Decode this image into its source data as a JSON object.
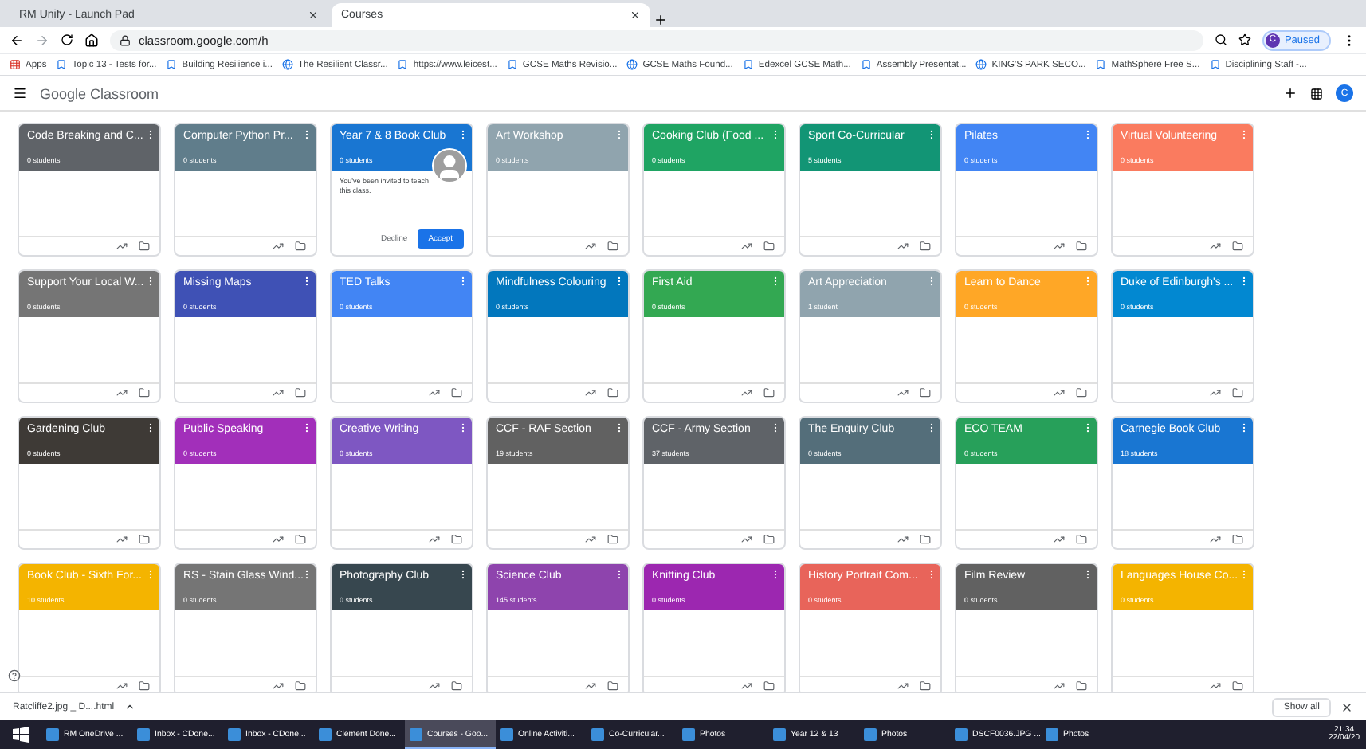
{
  "browser_tabs": [
    {
      "title": "RM Unify - Launch Pad",
      "selected": false
    },
    {
      "title": "Courses",
      "selected": true
    }
  ],
  "address": "classroom.google.com/h",
  "profile": {
    "initial": "C",
    "status": "Paused"
  },
  "bookmarks": [
    "Apps",
    "Topic 13 - Tests for...",
    "Building Resilience i...",
    "The Resilient Classr...",
    "https://www.leicest...",
    "GCSE Maths Revisio...",
    "GCSE Maths Found...",
    "Edexcel GCSE Math...",
    "Assembly Presentat...",
    "KING'S PARK SECO...",
    "MathSphere Free S...",
    "Disciplining Staff -..."
  ],
  "app_bar": {
    "brand": "Google",
    "product": "Classroom",
    "avatar": "C"
  },
  "courses": [
    {
      "title": "Code Breaking and C...",
      "students": "0 students",
      "color": "#5f6368"
    },
    {
      "title": "Computer Python Pr...",
      "students": "0 students",
      "color": "#607d8b"
    },
    {
      "title": "Year 7 & 8 Book Club",
      "students": "0 students",
      "color": "#1976d2",
      "kind": "invite",
      "message": "You've been invited to teach this class.",
      "decline": "Decline",
      "accept": "Accept"
    },
    {
      "title": "Art Workshop",
      "students": "0 students",
      "color": "#90a4ae"
    },
    {
      "title": "Cooking Club (Food ...",
      "students": "0 students",
      "color": "#1fa463"
    },
    {
      "title": "Sport Co-Curricular",
      "students": "5 students",
      "color": "#129575"
    },
    {
      "title": "Pilates",
      "students": "0 students",
      "color": "#4285f4"
    },
    {
      "title": "Virtual Volunteering",
      "students": "0 students",
      "color": "#fa7b5f"
    },
    {
      "title": "Support Your Local W...",
      "students": "0 students",
      "color": "#757575"
    },
    {
      "title": "Missing Maps",
      "students": "0 students",
      "color": "#3f51b5"
    },
    {
      "title": "TED Talks",
      "students": "0 students",
      "color": "#4285f4"
    },
    {
      "title": "Mindfulness Colouring",
      "students": "0 students",
      "color": "#0277bd"
    },
    {
      "title": "First Aid",
      "students": "0 students",
      "color": "#33a852"
    },
    {
      "title": "Art Appreciation",
      "students": "1 student",
      "color": "#90a4ae"
    },
    {
      "title": "Learn to Dance",
      "students": "0 students",
      "color": "#ffa726"
    },
    {
      "title": "Duke of Edinburgh's ...",
      "students": "0 students",
      "color": "#0288d1"
    },
    {
      "title": "Gardening Club",
      "students": "0 students",
      "color": "#3e3a36"
    },
    {
      "title": "Public Speaking",
      "students": "0 students",
      "color": "#a22fba"
    },
    {
      "title": "Creative Writing",
      "students": "0 students",
      "color": "#7e57c2"
    },
    {
      "title": "CCF - RAF Section",
      "students": "19 students",
      "color": "#616161"
    },
    {
      "title": "CCF - Army Section",
      "students": "37 students",
      "color": "#5f6368"
    },
    {
      "title": "The Enquiry Club",
      "students": "0 students",
      "color": "#546e7a"
    },
    {
      "title": "ECO TEAM",
      "students": "0 students",
      "color": "#27a05a"
    },
    {
      "title": "Carnegie Book Club",
      "students": "18 students",
      "color": "#1976d2"
    },
    {
      "title": "Book Club - Sixth For...",
      "students": "10 students",
      "color": "#f4b400"
    },
    {
      "title": "RS - Stain Glass Wind...",
      "students": "0 students",
      "color": "#757575"
    },
    {
      "title": "Photography Club",
      "students": "0 students",
      "color": "#37474f"
    },
    {
      "title": "Science Club",
      "students": "145 students",
      "color": "#8e44ad"
    },
    {
      "title": "Knitting Club",
      "students": "0 students",
      "color": "#9c27b0"
    },
    {
      "title": "History Portrait Com...",
      "students": "0 students",
      "color": "#e8645a"
    },
    {
      "title": "Film Review",
      "students": "0 students",
      "color": "#616161"
    },
    {
      "title": "Languages House Co...",
      "students": "0 students",
      "color": "#f4b400"
    }
  ],
  "download": {
    "file": "Ratcliffe2.jpg _ D....html",
    "show_all": "Show all"
  },
  "taskbar": [
    {
      "label": "RM OneDrive ...",
      "selected": false
    },
    {
      "label": "Inbox - CDone...",
      "selected": false
    },
    {
      "label": "Inbox - CDone...",
      "selected": false
    },
    {
      "label": "Clement Done...",
      "selected": false
    },
    {
      "label": "Courses - Goo...",
      "selected": true
    },
    {
      "label": "Online Activiti...",
      "selected": false
    },
    {
      "label": "Co-Curricular...",
      "selected": false
    },
    {
      "label": "Photos",
      "selected": false
    },
    {
      "label": "Year 12 & 13",
      "selected": false
    },
    {
      "label": "Photos",
      "selected": false
    },
    {
      "label": "DSCF0036.JPG ...",
      "selected": false
    },
    {
      "label": "Photos",
      "selected": false
    }
  ],
  "clock": {
    "time": "21:34",
    "date": "22/04/20"
  }
}
